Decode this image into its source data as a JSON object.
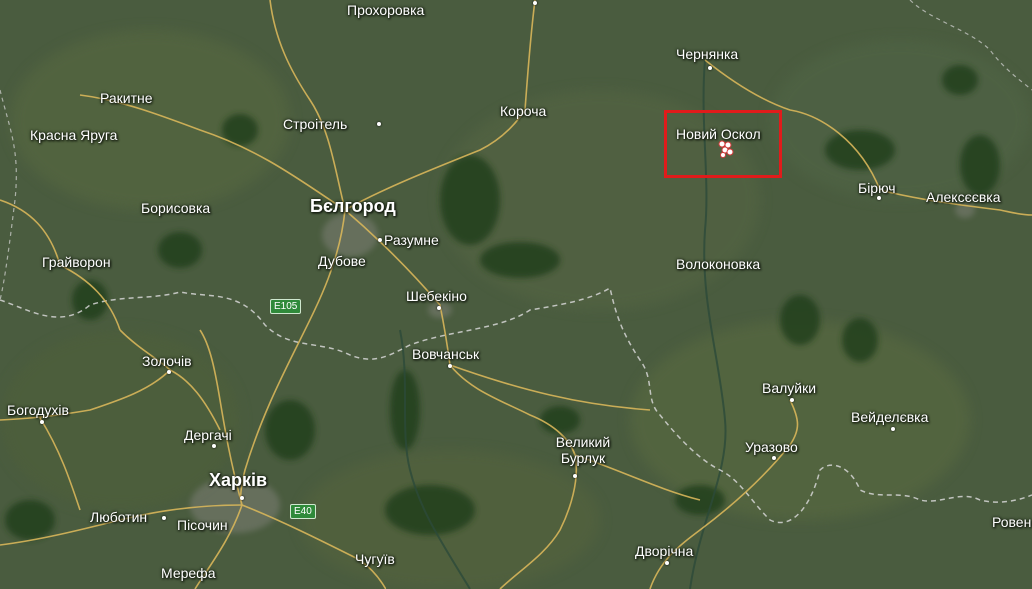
{
  "map": {
    "colors": {
      "land": "#4a5c3f",
      "forest": "#24401f",
      "road": "#d8b65a",
      "border": "#d6d6d6",
      "highlight": "#e11b1b",
      "motorway_shield": "#2f8a3a"
    },
    "places": [
      {
        "id": "prokhorovka",
        "label": "Прохоровка"
      },
      {
        "id": "chernyanka",
        "label": "Чернянка"
      },
      {
        "id": "rakytne",
        "label": "Ракитне"
      },
      {
        "id": "krasna-yaruha",
        "label": "Красна Яруга"
      },
      {
        "id": "stroitel",
        "label": "Строітель"
      },
      {
        "id": "korocha",
        "label": "Короча"
      },
      {
        "id": "novyi-oskol",
        "label": "Новий Оскол"
      },
      {
        "id": "biruch",
        "label": "Бірюч"
      },
      {
        "id": "alekseevka",
        "label": "Алексєєвка"
      },
      {
        "id": "borysovka",
        "label": "Борисовка"
      },
      {
        "id": "belgorod",
        "label": "Бєлгород"
      },
      {
        "id": "razumne",
        "label": "Разумне"
      },
      {
        "id": "hraivoron",
        "label": "Грайворон"
      },
      {
        "id": "dubove",
        "label": "Дубове"
      },
      {
        "id": "volokonovka",
        "label": "Волоконовка"
      },
      {
        "id": "shebekino",
        "label": "Шебекіно"
      },
      {
        "id": "zolochiv",
        "label": "Золочів"
      },
      {
        "id": "vovchansk",
        "label": "Вовчанськ"
      },
      {
        "id": "valuiky",
        "label": "Валуйки"
      },
      {
        "id": "bohodukhiv",
        "label": "Богодухів"
      },
      {
        "id": "veidelevka",
        "label": "Вейделєвка"
      },
      {
        "id": "derhachi",
        "label": "Дергачі"
      },
      {
        "id": "velykyi-burluk",
        "label": "Великий Бурлук"
      },
      {
        "id": "urazovo",
        "label": "Уразово"
      },
      {
        "id": "kharkiv",
        "label": "Харків"
      },
      {
        "id": "liubotyn",
        "label": "Люботин"
      },
      {
        "id": "pisochyn",
        "label": "Пісочин"
      },
      {
        "id": "chuhuiv",
        "label": "Чугуїв"
      },
      {
        "id": "dvorichna",
        "label": "Дворічна"
      },
      {
        "id": "merefa",
        "label": "Мерефа"
      },
      {
        "id": "rovenky",
        "label": "Ровен"
      }
    ],
    "road_shields": [
      {
        "id": "e105",
        "label": "E105"
      },
      {
        "id": "e40",
        "label": "E40"
      }
    ],
    "highlight": {
      "place": "Новий Оскол"
    }
  }
}
